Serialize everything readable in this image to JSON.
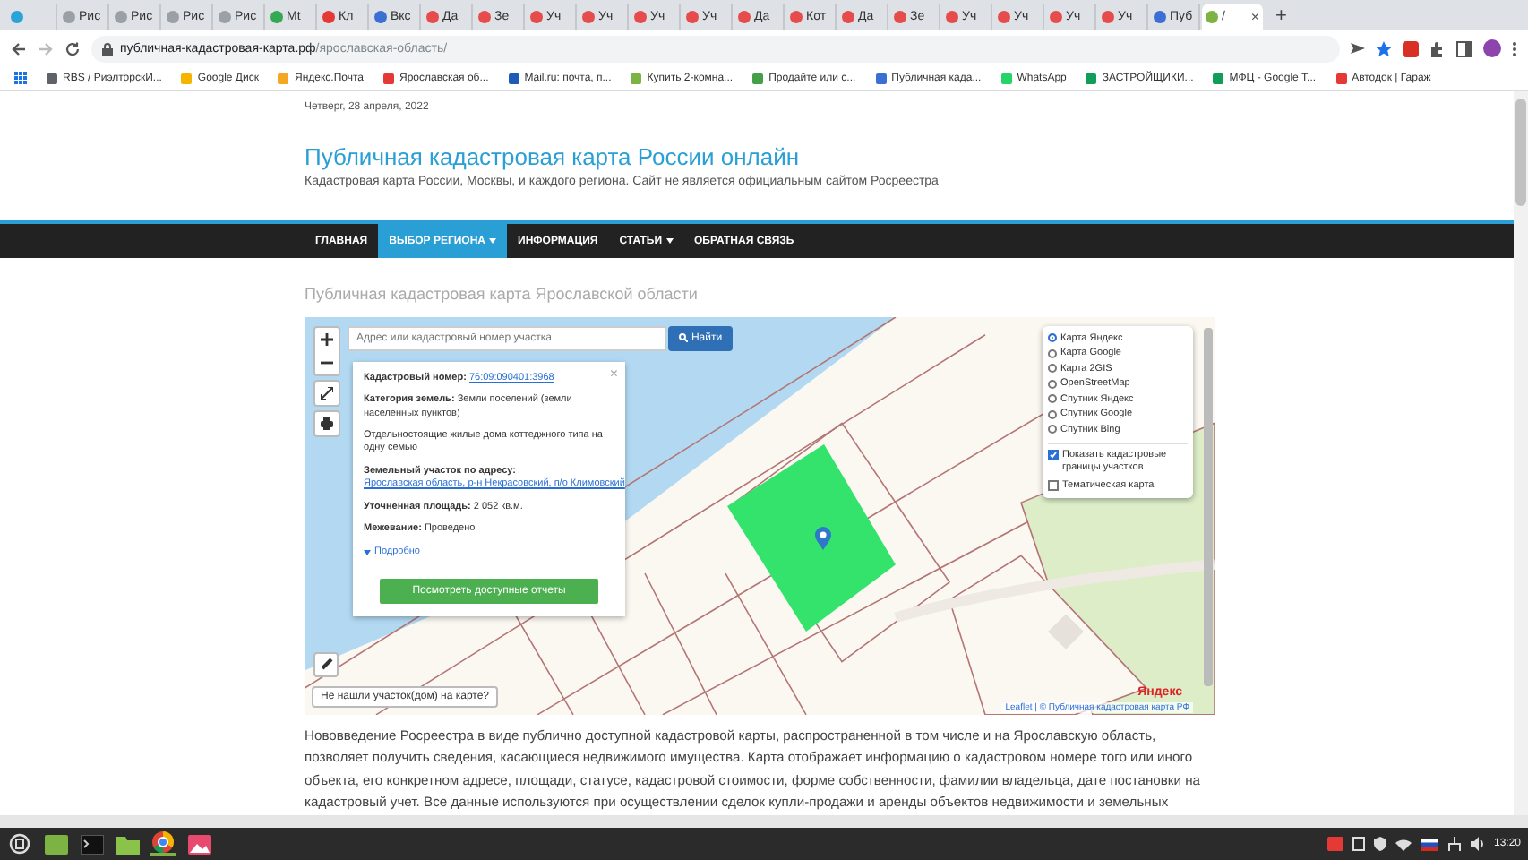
{
  "browser": {
    "tabs": [
      {
        "color": "#2aa3d8",
        "selected": false
      },
      {
        "label": "Рис",
        "color": "#9aa0a6",
        "selected": false
      },
      {
        "label": "Рис",
        "color": "#9aa0a6",
        "selected": false
      },
      {
        "label": "Рис",
        "color": "#9aa0a6",
        "selected": false
      },
      {
        "label": "Рис",
        "color": "#9aa0a6",
        "selected": false
      },
      {
        "label": "Mt",
        "color": "#34a853",
        "selected": false
      },
      {
        "label": "Кл",
        "color": "#e53935",
        "selected": false
      },
      {
        "label": "Вкс",
        "color": "#3b6fd4",
        "selected": false
      },
      {
        "label": "Да",
        "color": "#e74c4c",
        "selected": false
      },
      {
        "label": "Зе",
        "color": "#e74c4c",
        "selected": false
      },
      {
        "label": "Уч",
        "color": "#e74c4c",
        "selected": false
      },
      {
        "label": "Уч",
        "color": "#e74c4c",
        "selected": false
      },
      {
        "label": "Уч",
        "color": "#e74c4c",
        "selected": false
      },
      {
        "label": "Уч",
        "color": "#e74c4c",
        "selected": false
      },
      {
        "label": "Да",
        "color": "#e74c4c",
        "selected": false
      },
      {
        "label": "Кот",
        "color": "#e74c4c",
        "selected": false
      },
      {
        "label": "Да",
        "color": "#e74c4c",
        "selected": false
      },
      {
        "label": "Зе",
        "color": "#e74c4c",
        "selected": false
      },
      {
        "label": "Уч",
        "color": "#e74c4c",
        "selected": false
      },
      {
        "label": "Уч",
        "color": "#e74c4c",
        "selected": false
      },
      {
        "label": "Уч",
        "color": "#e74c4c",
        "selected": false
      },
      {
        "label": "Уч",
        "color": "#e74c4c",
        "selected": false
      },
      {
        "label": "Пуб",
        "color": "#3b6fd4",
        "selected": false
      },
      {
        "label": "/",
        "color": "#7cb342",
        "selected": true
      }
    ],
    "close_tab": "×",
    "new_tab": "+",
    "address": {
      "host": "публичная-кадастровая-карта.рф",
      "path": "/ярославская-область/"
    },
    "bookmarks": [
      {
        "label": "RBS / РиэлторскИ...",
        "color": "#5f6368"
      },
      {
        "label": "Google Диск",
        "color": "#f4b400"
      },
      {
        "label": "Яндекс.Почта",
        "color": "#f5a623"
      },
      {
        "label": "Ярославская об...",
        "color": "#e53935"
      },
      {
        "label": "Mail.ru: почта, п...",
        "color": "#1e5bb8"
      },
      {
        "label": "Купить 2-комна...",
        "color": "#7cb342"
      },
      {
        "label": "Продайте или с...",
        "color": "#43a047"
      },
      {
        "label": "Публичная када...",
        "color": "#3b6fd4"
      },
      {
        "label": "WhatsApp",
        "color": "#25d366"
      },
      {
        "label": "ЗАСТРОЙЩИКИ...",
        "color": "#0f9d58"
      },
      {
        "label": "МФЦ - Google Т...",
        "color": "#0f9d58"
      },
      {
        "label": "Автодок | Гараж",
        "color": "#e53935"
      }
    ]
  },
  "page": {
    "date": "Четверг, 28 апреля, 2022",
    "site_title": "Публичная кадастровая карта России онлайн",
    "site_subtitle": "Кадастровая карта России, Москвы, и каждого региона. Сайт не является официальным сайтом Росреестра",
    "nav": [
      {
        "label": "ГЛАВНАЯ",
        "dropdown": false,
        "selected": false
      },
      {
        "label": "ВЫБОР РЕГИОНА",
        "dropdown": true,
        "selected": true
      },
      {
        "label": "ИНФОРМАЦИЯ",
        "dropdown": false,
        "selected": false
      },
      {
        "label": "СТАТЬИ",
        "dropdown": true,
        "selected": false
      },
      {
        "label": "ОБРАТНАЯ СВЯЗЬ",
        "dropdown": false,
        "selected": false
      }
    ],
    "heading": "Публичная кадастровая карта Ярославской области",
    "map": {
      "search": {
        "placeholder": "Адрес или кадастровый номер участка",
        "button": "Найти"
      },
      "popup": {
        "close": "×",
        "rows": [
          {
            "label": "Кадастровый номер:",
            "value": "76:09:090401:3968",
            "link": true
          },
          {
            "label": "Категория земель:",
            "value": "Земли поселений (земли населенных пунктов)",
            "link": false
          },
          {
            "value": "Отдельностоящие жилые дома коттеджного типа на одну семью",
            "link": false
          },
          {
            "label": "Земельный участок по адресу:",
            "value": "Ярославская область, р-н Некрасовский, п/о Климовский",
            "link": true
          },
          {
            "label": "Уточненная площадь:",
            "value": "2 052 кв.м.",
            "link": false
          },
          {
            "label": "Межевание:",
            "value": "Проведено",
            "link": false
          }
        ],
        "more": "Подробно",
        "action": "Посмотреть доступные отчеты"
      },
      "layers": [
        {
          "label": "Карта Яндекс",
          "selected": true
        },
        {
          "label": "Карта Google",
          "selected": false
        },
        {
          "label": "Карта 2GIS",
          "selected": false
        },
        {
          "label": "OpenStreetMap",
          "selected": false
        },
        {
          "label": "Спутник Яндекс",
          "selected": false
        },
        {
          "label": "Спутник Google",
          "selected": false
        },
        {
          "label": "Спутник Bing",
          "selected": false
        }
      ],
      "overlays": [
        {
          "label": "Показать кадастровые границы участков",
          "checked": true
        },
        {
          "label": "Тематическая карта",
          "checked": false
        }
      ],
      "missing_link": "Не нашли участок(дом) на карте?",
      "map_logo": "Яндекс",
      "attribution": "Leaflet | © Публичная кадастровая карта РФ"
    },
    "paragraph": "Нововведение Росреестра в виде публично доступной кадастровой карты, распространенной в том числе и на Ярославскую область, позволяет получить сведения, касающиеся недвижимого имущества. Карта отображает информацию о кадастровом номере того или иного объекта, его конкретном адресе, площади, статусе, кадастровой стоимости, форме собственности, фамилии владельца, дате постановки на кадастровый учет. Все данные используются при осуществлении сделок купли-продажи и аренды объектов недвижимости и земельных"
  },
  "taskbar": {
    "apps": [
      {
        "kind": "menu"
      },
      {
        "kind": "files"
      },
      {
        "kind": "terminal"
      },
      {
        "kind": "folder"
      },
      {
        "kind": "browser"
      },
      {
        "kind": "photos"
      }
    ],
    "clock": "13:20"
  }
}
